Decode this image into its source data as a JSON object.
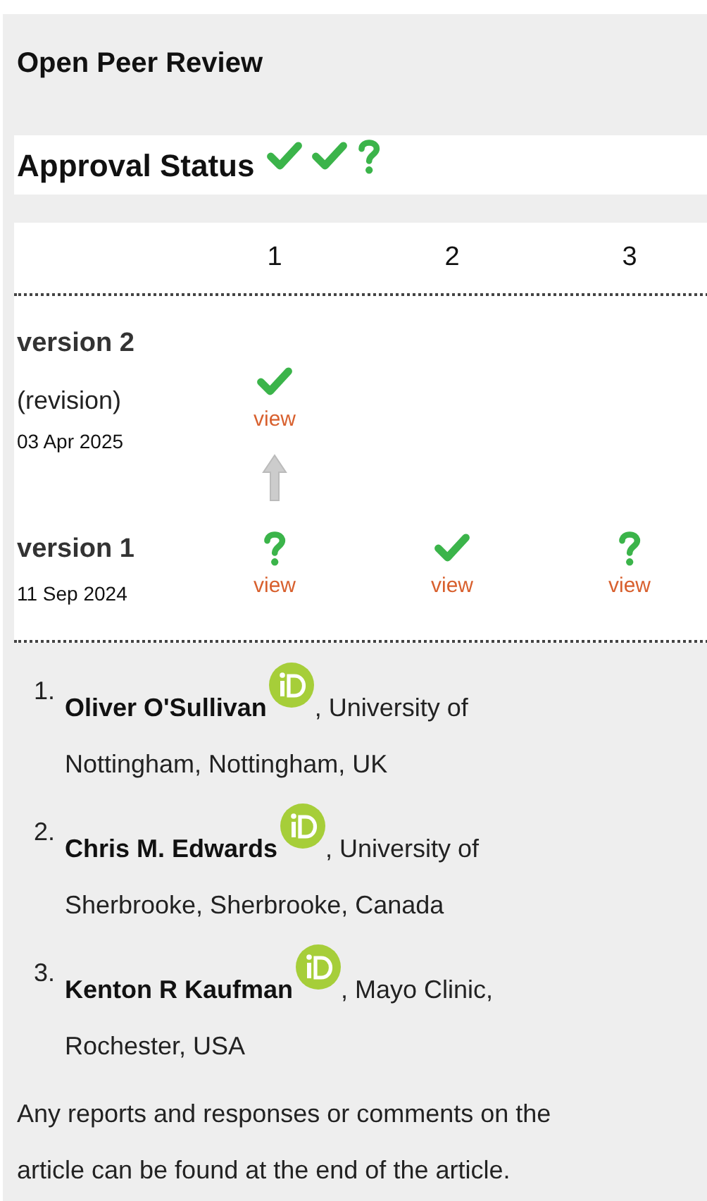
{
  "title": "Open Peer Review",
  "approval_status": {
    "label": "Approval Status",
    "icons": [
      {
        "kind": "approved"
      },
      {
        "kind": "approved"
      },
      {
        "kind": "reservations"
      }
    ]
  },
  "table": {
    "columns": [
      "1",
      "2",
      "3"
    ],
    "versions": [
      {
        "label": "version 2",
        "note": "(revision)",
        "date": "03 Apr 2025",
        "reports": [
          {
            "kind": "approved",
            "link": "view"
          }
        ]
      },
      {
        "label": "version 1",
        "date": "11 Sep 2024",
        "reports": [
          {
            "kind": "reservations",
            "link": "view"
          },
          {
            "kind": "approved",
            "link": "view"
          },
          {
            "kind": "reservations",
            "link": "view"
          }
        ]
      }
    ]
  },
  "reviewers": [
    {
      "number": "1.",
      "name": "Oliver O'Sullivan",
      "affiliation_lines": [
        ", University of",
        "Nottingham, Nottingham, UK"
      ]
    },
    {
      "number": "2.",
      "name": "Chris M. Edwards",
      "affiliation_lines": [
        ", University of",
        "Sherbrooke, Sherbrooke, Canada"
      ]
    },
    {
      "number": "3.",
      "name": "Kenton R Kaufman",
      "affiliation_lines": [
        ", Mayo Clinic,",
        "Rochester, USA"
      ]
    }
  ],
  "footer_note": "Any reports and responses or comments on the article can be found at the end of the article."
}
